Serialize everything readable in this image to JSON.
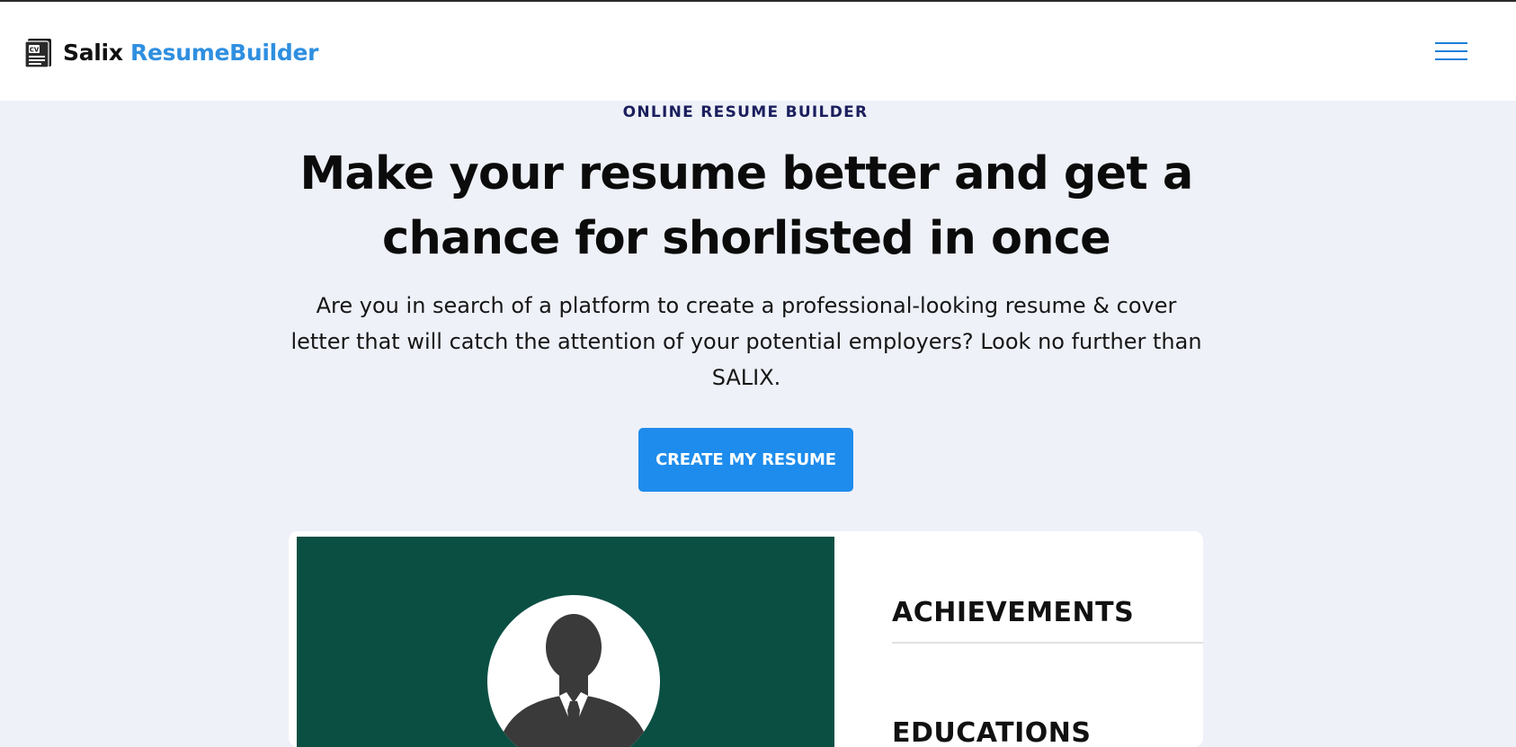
{
  "brand": {
    "name_part1": "Salix",
    "name_part2": "ResumeBuilder",
    "accent_color": "#2f8fe0",
    "icon": "cv-document-icon"
  },
  "nav": {
    "menu_icon": "hamburger-menu-icon"
  },
  "hero": {
    "eyebrow": "ONLINE RESUME BUILDER",
    "headline": "Make your resume better and get a chance for shorlisted in once",
    "lead": "Are you in search of a platform to create a professional-looking resume & cover letter that will catch the attention of your potential employers? Look no further than SALIX.",
    "cta_label": "CREATE MY RESUME",
    "cta_color": "#1e8cec"
  },
  "preview": {
    "sidebar_color": "#0b4f43",
    "avatar_icon": "person-silhouette-icon",
    "sections": [
      "ACHIEVEMENTS",
      "EDUCATIONS"
    ]
  }
}
